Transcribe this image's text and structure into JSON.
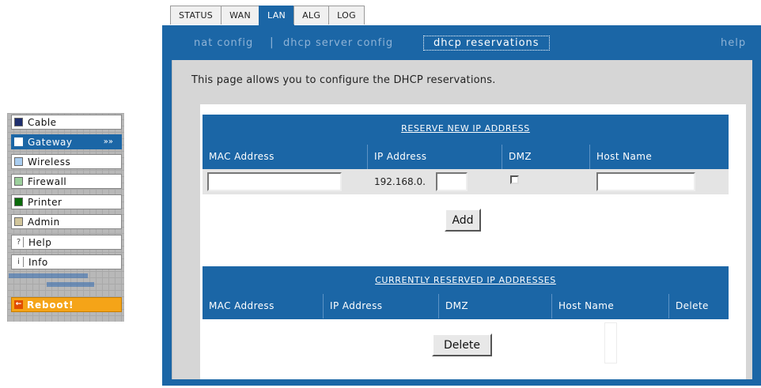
{
  "nav": {
    "items": [
      {
        "label": "Cable",
        "color": "#1f2f6e"
      },
      {
        "label": "Gateway",
        "color": "#ffffff",
        "arrow": "»»",
        "active": true
      },
      {
        "label": "Wireless",
        "color": "#a9cdf0"
      },
      {
        "label": "Firewall",
        "color": "#9ccf9c"
      },
      {
        "label": "Printer",
        "color": "#0b6b0b"
      },
      {
        "label": "Admin",
        "color": "#d1c59b"
      },
      {
        "label": "Help",
        "glyph": "?"
      },
      {
        "label": "Info",
        "glyph": "i"
      }
    ],
    "reboot": {
      "label": "Reboot!",
      "icon": "←"
    }
  },
  "tabs": [
    {
      "label": "STATUS"
    },
    {
      "label": "WAN"
    },
    {
      "label": "LAN",
      "active": true
    },
    {
      "label": "ALG"
    },
    {
      "label": "LOG"
    }
  ],
  "subnav": {
    "links": [
      "nat config",
      "dhcp server config",
      "dhcp reservations"
    ],
    "separator": "|",
    "active": "dhcp reservations",
    "help": "help"
  },
  "intro": "This page allows you to configure the DHCP reservations.",
  "reserve": {
    "title": "RESERVE NEW IP ADDRESS",
    "columns": [
      "MAC Address",
      "IP Address",
      "DMZ",
      "Host Name"
    ],
    "mac_value": "",
    "ip_prefix": "192.168.0.",
    "ip_suffix_value": "",
    "dmz_checked": false,
    "host_value": "",
    "add_label": "Add"
  },
  "reserved": {
    "title": "CURRENTLY RESERVED IP ADDRESSES",
    "columns": [
      "MAC Address",
      "IP Address",
      "DMZ",
      "Host Name",
      "Delete"
    ],
    "rows": [],
    "delete_label": "Delete"
  },
  "colors": {
    "accent": "#1b66a6",
    "reboot": "#f5a418"
  }
}
